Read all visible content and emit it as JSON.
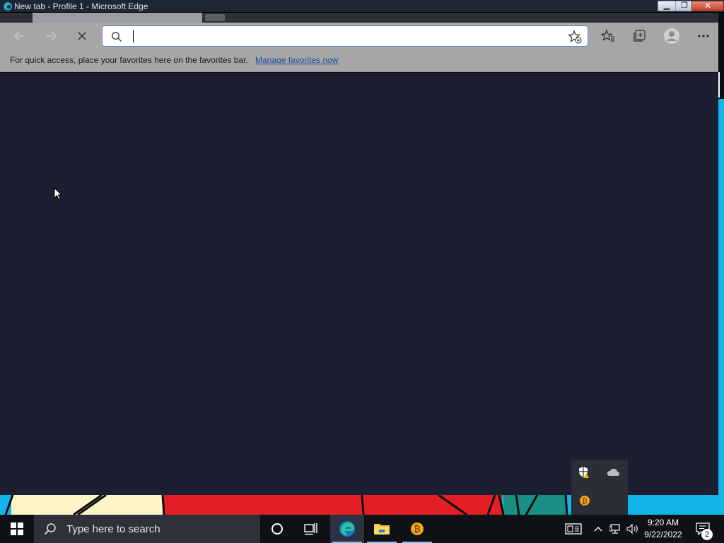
{
  "window": {
    "title": "New tab - Profile 1 - Microsoft Edge",
    "minimize_label": "▁",
    "restore_label": "❐",
    "close_label": "✕"
  },
  "toolbar": {
    "back_icon": "back-arrow-icon",
    "forward_icon": "forward-arrow-icon",
    "stop_icon": "stop-loading-icon",
    "favorites_icon": "favorites-icon",
    "collections_icon": "collections-icon",
    "profile_icon": "profile-avatar-icon",
    "more_icon": "more-menu-icon"
  },
  "addressbar": {
    "value": "",
    "placeholder": ""
  },
  "favorites_bar": {
    "message": "For quick access, place your favorites here on the favorites bar.",
    "link": "Manage favorites now"
  },
  "taskbar": {
    "search_placeholder": "Type here to search",
    "pinned": [
      "cortana-icon",
      "task-view-icon",
      "edge-icon",
      "file-explorer-icon",
      "bitcoin-app-icon"
    ],
    "clock_time": "9:20 AM",
    "clock_date": "9/22/2022",
    "notification_count": "2"
  },
  "colors": {
    "accent": "#5a8ad6",
    "content_bg": "#1c1f2f",
    "toolbar_bg": "#a6a6a6",
    "link": "#1a4f99",
    "taskbar_bg": "#0e1116"
  }
}
